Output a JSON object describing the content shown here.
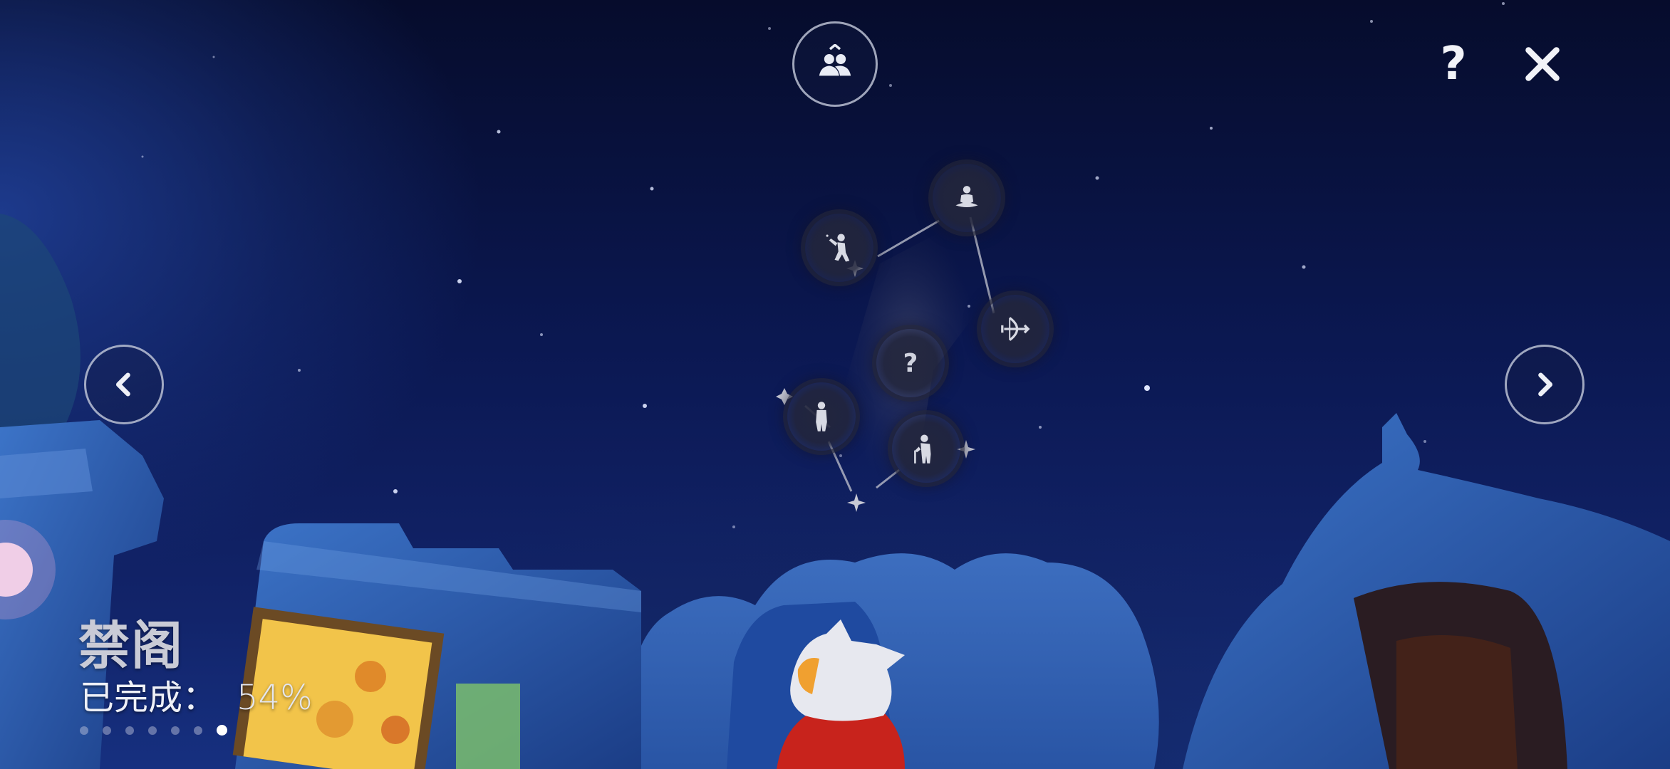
{
  "area": {
    "name": "禁阁",
    "progress_label": "已完成：",
    "progress_value": "54%",
    "progress_fraction": 0.54
  },
  "pagination": {
    "total": 7,
    "active_index": 6
  },
  "toolbar": {
    "help_symbol": "?",
    "close_symbol": "✕",
    "friends_icon": "friends-up-icon"
  },
  "navigation": {
    "prev_icon": "chevron-left-icon",
    "next_icon": "chevron-right-icon"
  },
  "constellation": {
    "nodes": [
      {
        "id": "meditate",
        "icon": "meditating-spirit-icon",
        "state": "found"
      },
      {
        "id": "cheer",
        "icon": "waving-spirit-icon",
        "state": "found"
      },
      {
        "id": "bow",
        "icon": "archer-spirit-icon",
        "state": "found"
      },
      {
        "id": "unknown",
        "icon": "question-icon",
        "label": "?",
        "state": "locked"
      },
      {
        "id": "stand",
        "icon": "standing-spirit-icon",
        "state": "found"
      },
      {
        "id": "cane",
        "icon": "elder-cane-spirit-icon",
        "state": "found"
      }
    ]
  },
  "colors": {
    "sky_top": "#060c2c",
    "sky_bottom": "#163080",
    "ui_white": "#f2f3f8",
    "dot_inactive": "#c8cde1"
  }
}
